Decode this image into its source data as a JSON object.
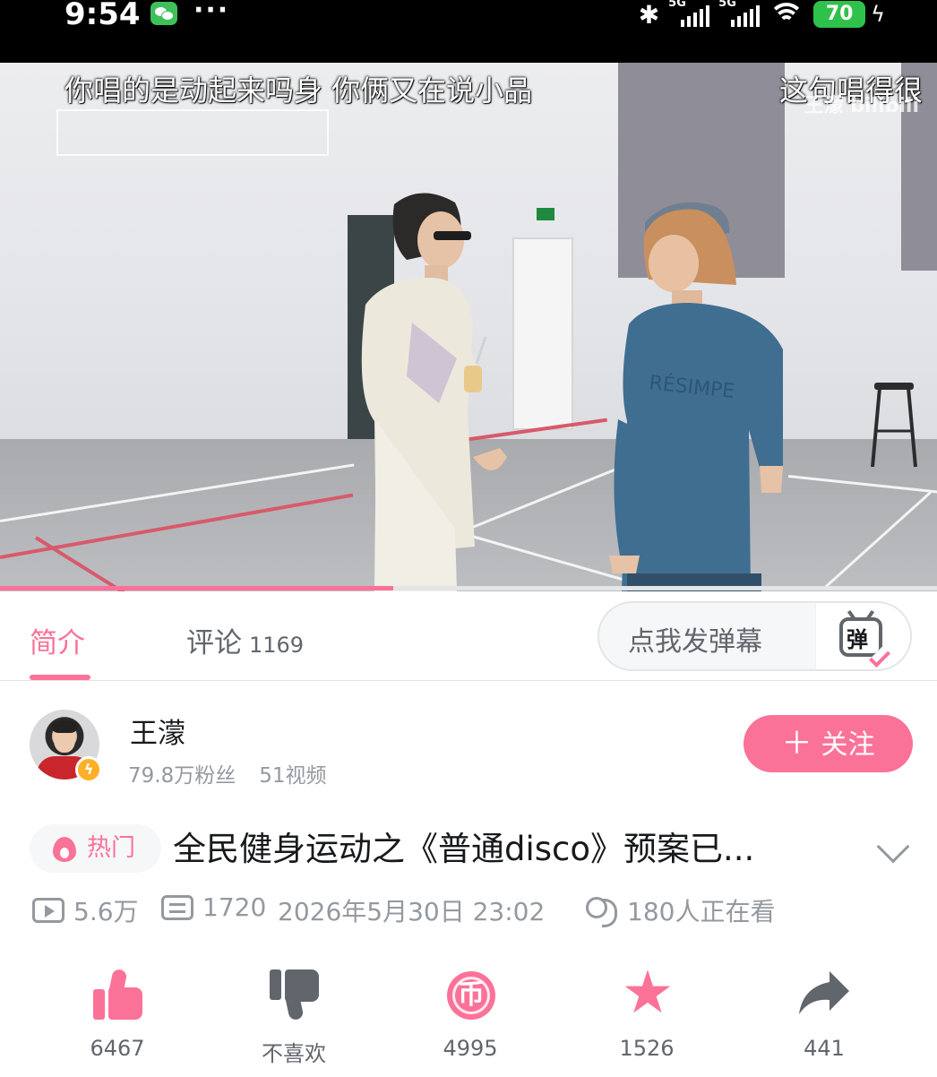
{
  "status_bar": {
    "time": "9:54",
    "dots": "···",
    "network_label_1": "5G",
    "network_label_2": "5G",
    "battery": "70"
  },
  "video": {
    "danmaku": [
      "你唱的是动起来吗身 你俩又在说小品",
      "这句唱得很"
    ],
    "watermark": "王濛 bilibili",
    "progress": 0.42
  },
  "tabs": {
    "intro_label": "简介",
    "comments_label": "评论",
    "comments_count": "1169",
    "danmaku_placeholder": "点我发弹幕",
    "danmaku_icon_char": "弹"
  },
  "uploader": {
    "name": "王濛",
    "fans": "79.8万粉丝",
    "videos": "51视频",
    "follow_label": "关注",
    "follow_plus": "＋"
  },
  "video_info": {
    "hot_badge": "热门",
    "title": "全民健身运动之《普通disco》预案已...",
    "views": "5.6万",
    "danmaku_count": "1720",
    "publish_time": "2026年5月30日 23:02",
    "watching": "180人正在看"
  },
  "actions": {
    "like": "6467",
    "dislike": "不喜欢",
    "coin": "4995",
    "coin_char": "币",
    "favorite": "1526",
    "share": "441"
  },
  "colors": {
    "accent_pink": "#fb7299",
    "text_primary": "#18191c",
    "text_secondary": "#61666d",
    "text_muted": "#9499a0"
  }
}
